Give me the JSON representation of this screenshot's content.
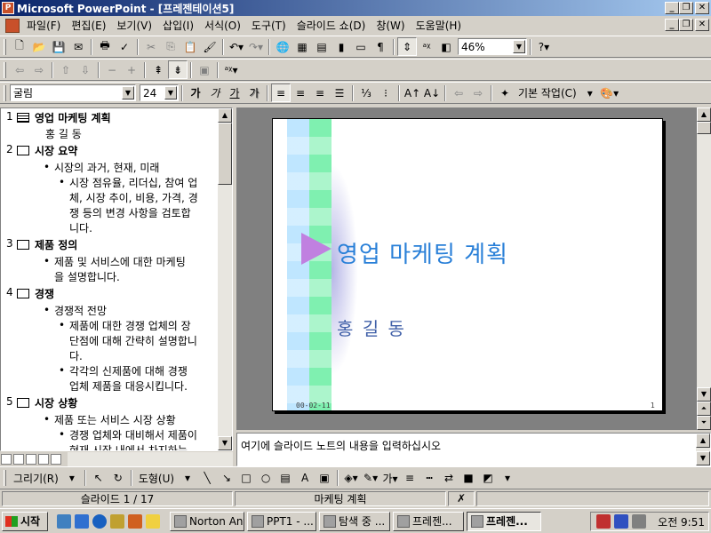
{
  "window": {
    "title": "Microsoft PowerPoint - [프레젠테이션5]"
  },
  "menu": {
    "items": [
      "파일(F)",
      "편집(E)",
      "보기(V)",
      "삽입(I)",
      "서식(O)",
      "도구(T)",
      "슬라이드 쇼(D)",
      "창(W)",
      "도움말(H)"
    ]
  },
  "standard_toolbar": {
    "zoom": "46%"
  },
  "formatting_toolbar": {
    "font_name": "굴림",
    "font_size": "24",
    "bold": "가",
    "italic": "가",
    "underline": "가",
    "shadow": "가",
    "design_label": "기본 작업(C)"
  },
  "outline": {
    "slides": [
      {
        "num": "1",
        "title": "영업 마케팅 계획",
        "lines": [
          {
            "text": "홍 길 동",
            "level": 0
          }
        ]
      },
      {
        "num": "2",
        "title": "시장 요약",
        "lines": [
          {
            "text": "시장의 과거, 현재, 미래",
            "level": 1
          },
          {
            "text": "시장 점유율, 리더십, 참여 업",
            "level": 2
          },
          {
            "text": "체, 시장 추이, 비용, 가격, 경",
            "level": 2,
            "cont": true
          },
          {
            "text": "쟁 등의 변경 사항을 검토합",
            "level": 2,
            "cont": true
          },
          {
            "text": "니다.",
            "level": 2,
            "cont": true
          }
        ]
      },
      {
        "num": "3",
        "title": "제품 정의",
        "lines": [
          {
            "text": "제품 및 서비스에 대한 마케팅",
            "level": 1
          },
          {
            "text": "을 설명합니다.",
            "level": 1,
            "cont": true
          }
        ]
      },
      {
        "num": "4",
        "title": "경쟁",
        "lines": [
          {
            "text": "경쟁적 전망",
            "level": 1
          },
          {
            "text": "제품에 대한 경쟁 업체의 장",
            "level": 2
          },
          {
            "text": "단점에 대해 간략히 설명합니",
            "level": 2,
            "cont": true
          },
          {
            "text": "다.",
            "level": 2,
            "cont": true
          },
          {
            "text": "각각의 신제품에 대해 경쟁",
            "level": 2
          },
          {
            "text": "업체 제품을 대응시킵니다.",
            "level": 2,
            "cont": true
          }
        ]
      },
      {
        "num": "5",
        "title": "시장 상황",
        "lines": [
          {
            "text": "제품 또는 서비스 시장 상황",
            "level": 1
          },
          {
            "text": "경쟁 업체와 대비해서 제품이",
            "level": 2
          },
          {
            "text": "현재 시장 내에서 차지하는",
            "level": 2,
            "cont": true
          }
        ]
      }
    ]
  },
  "slide": {
    "title": "영업 마케팅 계획",
    "subtitle": "홍 길 동",
    "date": "00-02-11",
    "number": "1"
  },
  "notes": {
    "text": "여기에 슬라이드 노트의 내용을 입력하십시오"
  },
  "drawing_toolbar": {
    "draw_label": "그리기(R)",
    "autoshape_label": "도형(U)"
  },
  "status": {
    "slide_info": "슬라이드 1 / 17",
    "design": "마케팅 계획"
  },
  "taskbar": {
    "start": "시작",
    "tasks": [
      {
        "label": "Norton Anti...",
        "active": false
      },
      {
        "label": "PPT1 - ...",
        "active": false
      },
      {
        "label": "탐색 중 ...",
        "active": false
      },
      {
        "label": "프레젠...",
        "active": false
      },
      {
        "label": "프레젠...",
        "active": true
      }
    ],
    "clock": "오전 9:51"
  }
}
